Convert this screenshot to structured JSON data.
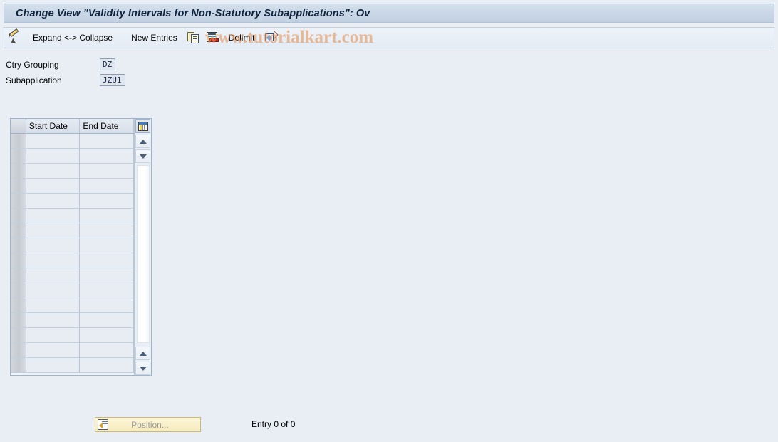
{
  "window": {
    "title": "Change View \"Validity Intervals for Non-Statutory Subapplications\": Ov"
  },
  "toolbar": {
    "edit_icon": "pencil-icon",
    "expand_collapse_label": "Expand <-> Collapse",
    "new_entries_label": "New Entries",
    "copy_icon": "copy-icon",
    "save_table_icon": "table-save-icon",
    "delimit_label": "Delimit",
    "delimit_icon": "delimit-icon"
  },
  "watermark": {
    "text": "www.tutorialkart.com",
    "color": "#e2965c"
  },
  "fields": [
    {
      "label": "Ctry Grouping",
      "value": "DZ"
    },
    {
      "label": "Subapplication",
      "value": "JZU1"
    }
  ],
  "grid": {
    "columns": [
      "Start Date",
      "End Date"
    ],
    "rows": [
      [
        "",
        ""
      ],
      [
        "",
        ""
      ],
      [
        "",
        ""
      ],
      [
        "",
        ""
      ],
      [
        "",
        ""
      ],
      [
        "",
        ""
      ],
      [
        "",
        ""
      ],
      [
        "",
        ""
      ],
      [
        "",
        ""
      ],
      [
        "",
        ""
      ],
      [
        "",
        ""
      ],
      [
        "",
        ""
      ],
      [
        "",
        ""
      ],
      [
        "",
        ""
      ],
      [
        "",
        ""
      ],
      [
        "",
        ""
      ]
    ],
    "config_icon": "column-config-icon",
    "scroll_up_icon": "scroll-up-icon",
    "scroll_down_icon": "scroll-down-icon"
  },
  "footer": {
    "position_button_label": "Position...",
    "position_button_icon": "position-icon",
    "entry_status": "Entry 0 of 0"
  }
}
